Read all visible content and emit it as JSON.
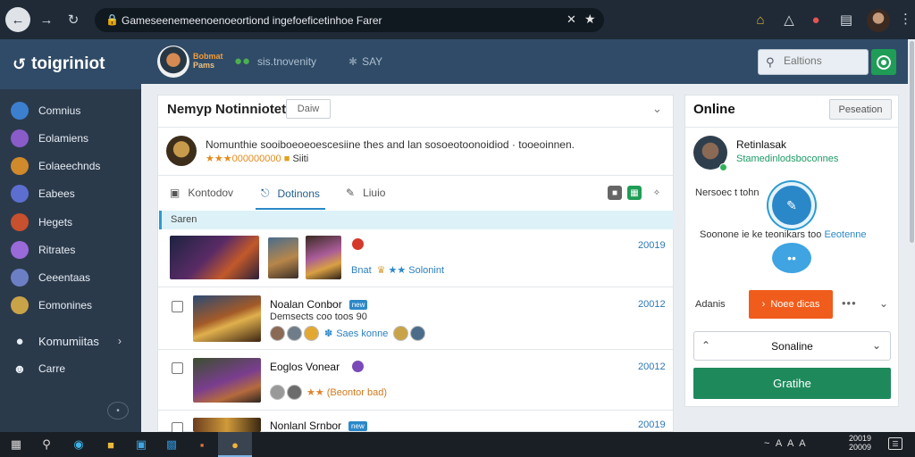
{
  "browser": {
    "url": "Gameseenemeenoenoeortiond ingefoeficetinhoe Farer"
  },
  "sidebar": {
    "brand": "toigriniot",
    "items": [
      {
        "label": "Comnius",
        "color": "#3d7fcf"
      },
      {
        "label": "Eolamiens",
        "color": "#8a5cc9"
      },
      {
        "label": "Eolaeechnds",
        "color": "#d08a2b"
      },
      {
        "label": "Eabees",
        "color": "#5c6fd0"
      },
      {
        "label": "Hegets",
        "color": "#c7502f"
      },
      {
        "label": "Ritrates",
        "color": "#9a6ad8"
      },
      {
        "label": "Ceeentaas",
        "color": "#6d7fc4"
      },
      {
        "label": "Eomonines",
        "color": "#c9a348"
      }
    ],
    "community": "Komumiitas",
    "games": "Carre"
  },
  "topbar": {
    "logo_text_1": "Bobmat",
    "logo_text_2": "Pams",
    "link_1": "sis.tnovenity",
    "link_2": "SAY",
    "search_placeholder": "Ealtions"
  },
  "main": {
    "title": "Nemyp",
    "title_2": "Notinniotet",
    "date_button": "Daiw",
    "post_text": "Nomunthie sooiboeoeoescesiine thes and lan sosoeotoonoidiod  ·  tooeoinnen.",
    "post_meta": "★★★000000000",
    "post_meta_2": "Siiti",
    "tabs": [
      {
        "label": "Kontodov"
      },
      {
        "label": "Dotinons"
      },
      {
        "label": "Liuio"
      }
    ],
    "section_label": "Saren",
    "rows": [
      {
        "meta": "Bnat",
        "meta_2": "Solonint",
        "date": "20019"
      },
      {
        "title": "Noalan Conbor",
        "badge": "new",
        "subtitle": "Demsects coo toos 90",
        "meta": "Saes konne",
        "date": "20012"
      },
      {
        "title": "Eoglos Vonear",
        "meta": "(Beontor bad)",
        "date": "20012"
      },
      {
        "title": "Nonlanl Srnbor",
        "badge": "new",
        "date": "20019"
      }
    ]
  },
  "right": {
    "title": "Online",
    "button": "Peseation",
    "user_name": "Retinlasak",
    "user_status": "Stamedinlodsboconnes",
    "label_1": "Nersoec t tohn",
    "text_2": "Soonone ie ke teonikars too",
    "text_2_link": "Eeotenne",
    "label_3": "Adanis",
    "orange_button": "Noee dicas",
    "select_value": "Sonaline",
    "green_button": "Gratihe"
  },
  "taskbar": {
    "clock_1": "20019",
    "clock_2": "20009",
    "tray": "~ A A A"
  }
}
